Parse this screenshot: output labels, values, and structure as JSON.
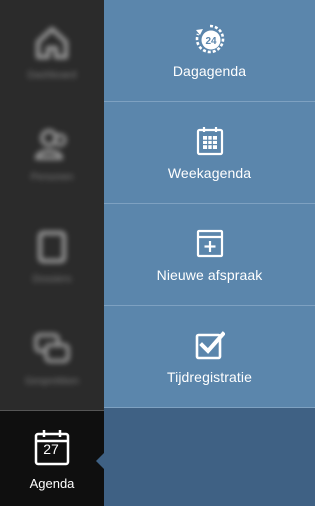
{
  "rail": {
    "items": [
      {
        "label": "Dashboard",
        "icon": "home-icon"
      },
      {
        "label": "Personen",
        "icon": "people-icon"
      },
      {
        "label": "Dossiers",
        "icon": "folder-icon"
      },
      {
        "label": "Gesprekken",
        "icon": "chat-icon"
      }
    ],
    "active": {
      "label": "Agenda",
      "day": "27",
      "icon": "calendar-icon"
    }
  },
  "menu": {
    "items": [
      {
        "label": "Dagagenda",
        "icon": "day-24-icon"
      },
      {
        "label": "Weekagenda",
        "icon": "week-calendar-icon"
      },
      {
        "label": "Nieuwe afspraak",
        "icon": "calendar-plus-icon"
      },
      {
        "label": "Tijdregistratie",
        "icon": "checkbox-icon"
      }
    ]
  },
  "colors": {
    "rail": "#2b2b2b",
    "rail_active": "#0f0f0f",
    "menu_item": "#5b86ac",
    "panel": "#3f6184"
  }
}
